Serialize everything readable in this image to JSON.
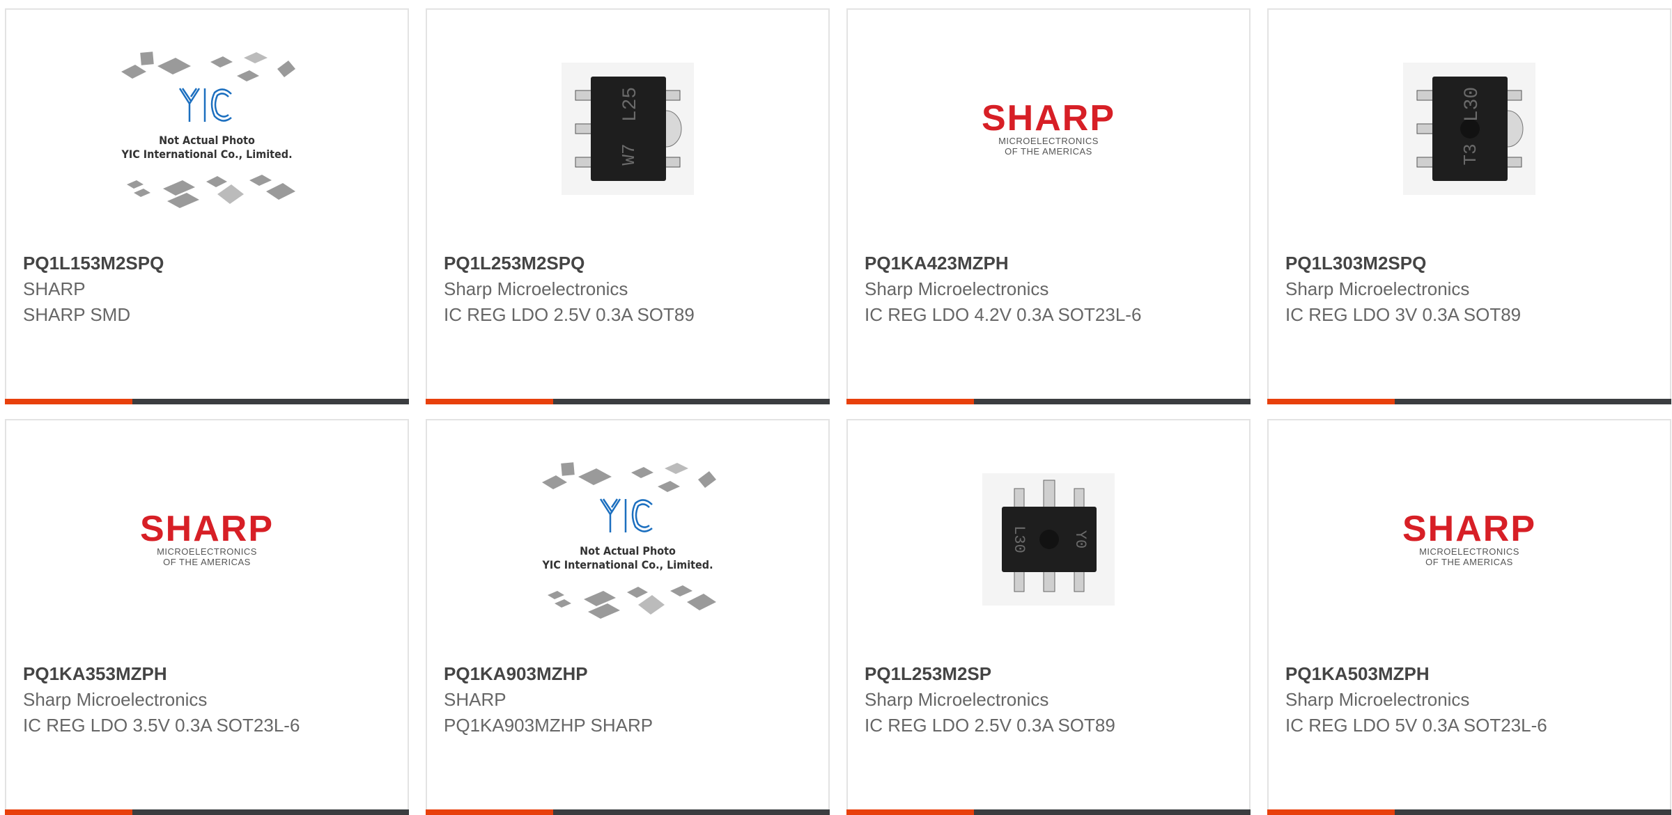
{
  "products": [
    {
      "part_number": "PQ1L153M2SPQ",
      "manufacturer": "SHARP",
      "description": "SHARP SMD",
      "image": "not-actual-photo-icon",
      "placeholder_caption_1": "Not Actual Photo",
      "placeholder_caption_2": "YIC International Co., Limited."
    },
    {
      "part_number": "PQ1L253M2SPQ",
      "manufacturer": "Sharp Microelectronics",
      "description": "IC REG LDO 2.5V 0.3A SOT89",
      "image": "chip-photo-icon",
      "chip_marking_top": "L25",
      "chip_marking_bottom": "W7"
    },
    {
      "part_number": "PQ1KA423MZPH",
      "manufacturer": "Sharp Microelectronics",
      "description": "IC REG LDO 4.2V 0.3A SOT23L-6",
      "image": "sharp-logo-icon",
      "logo_word": "SHARP",
      "logo_line_1": "MICROELECTRONICS",
      "logo_line_2": "OF THE AMERICAS"
    },
    {
      "part_number": "PQ1L303M2SPQ",
      "manufacturer": "Sharp Microelectronics",
      "description": "IC REG LDO 3V 0.3A SOT89",
      "image": "chip-photo-icon",
      "chip_marking_top": "L30",
      "chip_marking_bottom": "T3"
    },
    {
      "part_number": "PQ1KA353MZPH",
      "manufacturer": "Sharp Microelectronics",
      "description": "IC REG LDO 3.5V 0.3A SOT23L-6",
      "image": "sharp-logo-icon",
      "logo_word": "SHARP",
      "logo_line_1": "MICROELECTRONICS",
      "logo_line_2": "OF THE AMERICAS"
    },
    {
      "part_number": "PQ1KA903MZHP",
      "manufacturer": "SHARP",
      "description": "PQ1KA903MZHP SHARP",
      "image": "not-actual-photo-icon",
      "placeholder_caption_1": "Not Actual Photo",
      "placeholder_caption_2": "YIC International Co., Limited."
    },
    {
      "part_number": "PQ1L253M2SP",
      "manufacturer": "Sharp Microelectronics",
      "description": "IC REG LDO 2.5V 0.3A SOT89",
      "image": "chip-photo-icon",
      "chip_marking_top": "L30",
      "chip_marking_bottom": "Y0"
    },
    {
      "part_number": "PQ1KA503MZPH",
      "manufacturer": "Sharp Microelectronics",
      "description": "IC REG LDO 5V 0.3A SOT23L-6",
      "image": "sharp-logo-icon",
      "logo_word": "SHARP",
      "logo_line_1": "MICROELECTRONICS",
      "logo_line_2": "OF THE AMERICAS"
    }
  ],
  "colors": {
    "accent": "#e8400c",
    "bar": "#3b3d40",
    "border": "#e3e3e3",
    "brand_red": "#d71f26"
  }
}
